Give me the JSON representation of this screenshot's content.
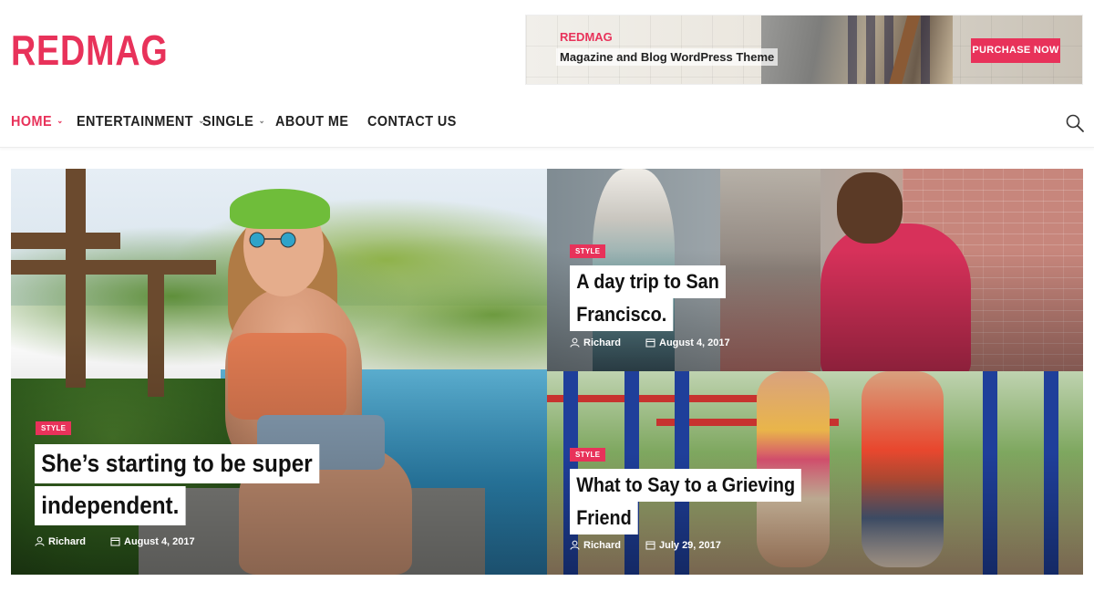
{
  "site": {
    "logo": "REDMAG"
  },
  "ad": {
    "brand": "REDMAG",
    "tagline": "Magazine and Blog WordPress Theme",
    "cta": "PURCHASE NOW"
  },
  "nav": {
    "items": [
      {
        "label": "HOME",
        "has_dropdown": true,
        "active": true
      },
      {
        "label": "ENTERTAINMENT",
        "has_dropdown": true,
        "active": false
      },
      {
        "label": "SINGLE",
        "has_dropdown": true,
        "active": false
      },
      {
        "label": "ABOUT ME",
        "has_dropdown": false,
        "active": false
      },
      {
        "label": "CONTACT US",
        "has_dropdown": false,
        "active": false
      }
    ],
    "dropdown_glyph": "⌄",
    "search_icon": "search-icon"
  },
  "featured": [
    {
      "category": "STYLE",
      "title_lines": [
        "She’s starting to be super",
        "independent."
      ],
      "author": "Richard",
      "date": "August 4, 2017"
    },
    {
      "category": "STYLE",
      "title_lines": [
        "A day trip to San",
        "Francisco."
      ],
      "author": "Richard",
      "date": "August 4, 2017"
    },
    {
      "category": "STYLE",
      "title_lines": [
        "What to Say to a Grieving",
        "Friend"
      ],
      "author": "Richard",
      "date": "July 29, 2017"
    }
  ],
  "colors": {
    "accent": "#e8325a",
    "text": "#222222",
    "background": "#ffffff"
  }
}
